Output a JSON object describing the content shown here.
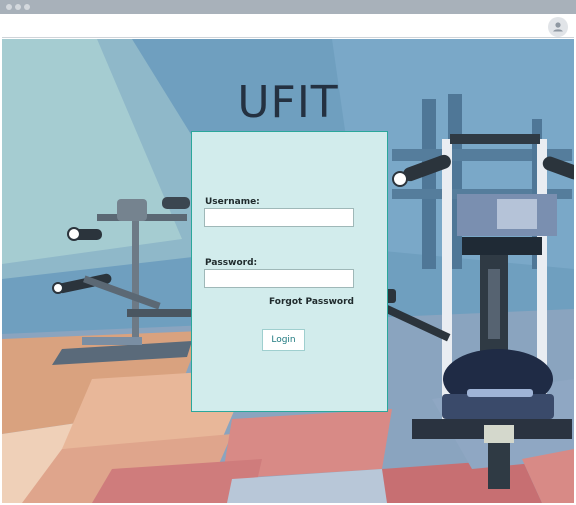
{
  "app": {
    "title": "UFIT"
  },
  "login": {
    "username_label": "Username:",
    "username_value": "",
    "password_label": "Password:",
    "password_value": "",
    "forgot_password": "Forgot Password",
    "login_button": "Login"
  },
  "colors": {
    "panel_background": "#d2ecec",
    "panel_border": "#2aa79b",
    "title_text": "#243141",
    "login_text": "#207a80"
  },
  "icons": {
    "user": "user-icon",
    "window_controls": "window-dots"
  }
}
